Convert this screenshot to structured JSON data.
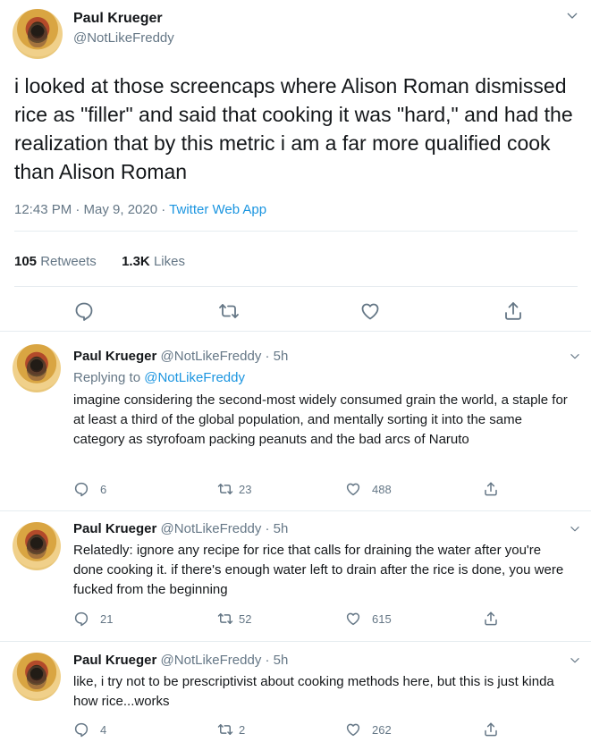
{
  "main_tweet": {
    "author_name": "Paul Krueger",
    "author_handle": "@NotLikeFreddy",
    "text": "i looked at those screencaps where Alison Roman dismissed rice as \"filler\" and said that cooking it was \"hard,\" and had the realization that by this metric i am a far more qualified cook than Alison Roman",
    "time_date": "12:43 PM · May 9, 2020 · ",
    "source_app": "Twitter Web App",
    "retweets_count": "105",
    "retweets_label": "Retweets",
    "likes_count": "1.3K",
    "likes_label": "Likes",
    "icons": {
      "chevron": "chevron-down-icon",
      "reply": "reply-icon",
      "retweet": "retweet-icon",
      "like": "like-icon",
      "share": "share-icon"
    }
  },
  "replies": [
    {
      "author_name": "Paul Krueger",
      "author_handle": "@NotLikeFreddy",
      "time": "· 5h",
      "replying_to_label": "Replying to",
      "replying_to_handle": "@NotLikeFreddy",
      "text": "imagine considering the second-most widely consumed grain the world, a staple for at least a third of the global population, and mentally sorting it into the same category as styrofoam packing peanuts and the bad arcs of Naruto",
      "reply_count": "6",
      "retweet_count": "23",
      "like_count": "488"
    },
    {
      "author_name": "Paul Krueger",
      "author_handle": "@NotLikeFreddy",
      "time": "· 5h",
      "text": "Relatedly: ignore any recipe for rice that calls for draining the water after you're done cooking it. if there's enough water left to drain after the rice is done, you were fucked from the beginning",
      "reply_count": "21",
      "retweet_count": "52",
      "like_count": "615"
    },
    {
      "author_name": "Paul Krueger",
      "author_handle": "@NotLikeFreddy",
      "time": "· 5h",
      "text": "like, i try not to be prescriptivist about cooking methods here, but this is just kinda how rice...works",
      "reply_count": "4",
      "retweet_count": "2",
      "like_count": "262"
    }
  ],
  "colors": {
    "text": "#14171a",
    "secondary": "#657786",
    "link": "#1b95e0",
    "border": "#e6ecf0"
  }
}
